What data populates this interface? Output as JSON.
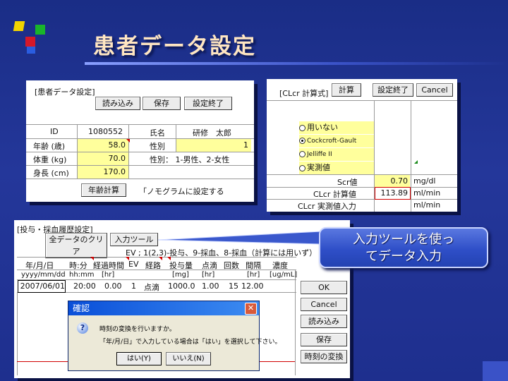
{
  "slide": {
    "title": "患者データ設定"
  },
  "callout": {
    "line1": "入力ツールを使っ",
    "line2": "てデータ入力"
  },
  "patient": {
    "header": "[患者データ設定]",
    "buttons": {
      "load": "読み込み",
      "save": "保存",
      "finish": "設定終了",
      "age_calc": "年齢計算"
    },
    "labels": {
      "id": "ID",
      "age": "年齢 (歳)",
      "weight": "体重 (kg)",
      "height": "身長 (cm)",
      "name": "氏名",
      "sex": "性別",
      "sex_note": "性別： 1-男性、2-女性",
      "nomogram": "「ノモグラムに設定する"
    },
    "values": {
      "id": "1080552",
      "name": "研修　太郎",
      "age": "58.0",
      "sex": "1",
      "weight": "70.0",
      "height": "170.0"
    }
  },
  "clcr": {
    "header": "[CLcr 計算式]",
    "buttons": {
      "calc": "計算",
      "finish": "設定終了",
      "cancel": "Cancel"
    },
    "options": [
      "用いない",
      "Cockcroft-Gault",
      "Jelliffe II",
      "実測値"
    ],
    "selected": "Cockcroft-Gault",
    "rows": [
      {
        "label": "Scr値",
        "value": "0.70",
        "unit": "mg/dl"
      },
      {
        "label": "CLcr 計算値",
        "value": "113.89",
        "unit": "ml/min"
      },
      {
        "label": "CLcr 実測値入力",
        "value": "",
        "unit": "ml/min"
      }
    ]
  },
  "dosing": {
    "header": "[投与・採血履歴設定]",
    "buttons": {
      "clear": "全データのクリア",
      "input_tool": "入力ツール",
      "ok": "OK",
      "cancel": "Cancel",
      "load": "読み込み",
      "save": "保存",
      "time_convert": "時刻の変換"
    },
    "note": "EV ; 1(2,3)-投与、9-採血、8-採血（計算には用いず）",
    "headers": [
      "年/月/日",
      "時:分",
      "経過時間",
      "EV",
      "経路",
      "投与量",
      "点滴",
      "回数",
      "間隔",
      "濃度"
    ],
    "units": [
      "yyyy/mm/dd",
      "hh:mm",
      "[hr]",
      "",
      "",
      "[mg]",
      "[hr]",
      "",
      "[hr]",
      "[ug/mL]"
    ],
    "rows": [
      [
        "2007/06/01",
        "20:00",
        "0.00",
        "1",
        "点滴",
        "1000.0",
        "1.00",
        "15",
        "12.00",
        ""
      ]
    ]
  },
  "dialog": {
    "title": "確認",
    "line1": "時刻の変換を行いますか。",
    "line2": "「年/月/日」で入力している場合は「はい」を選択して下さい。",
    "yes": "はい(Y)",
    "no": "いいえ(N)"
  },
  "colors": {
    "background": "#1e2f8e",
    "title": "#ffe6c2",
    "input_yellow": "#ffff9c",
    "callout": "#2f4fc8"
  }
}
